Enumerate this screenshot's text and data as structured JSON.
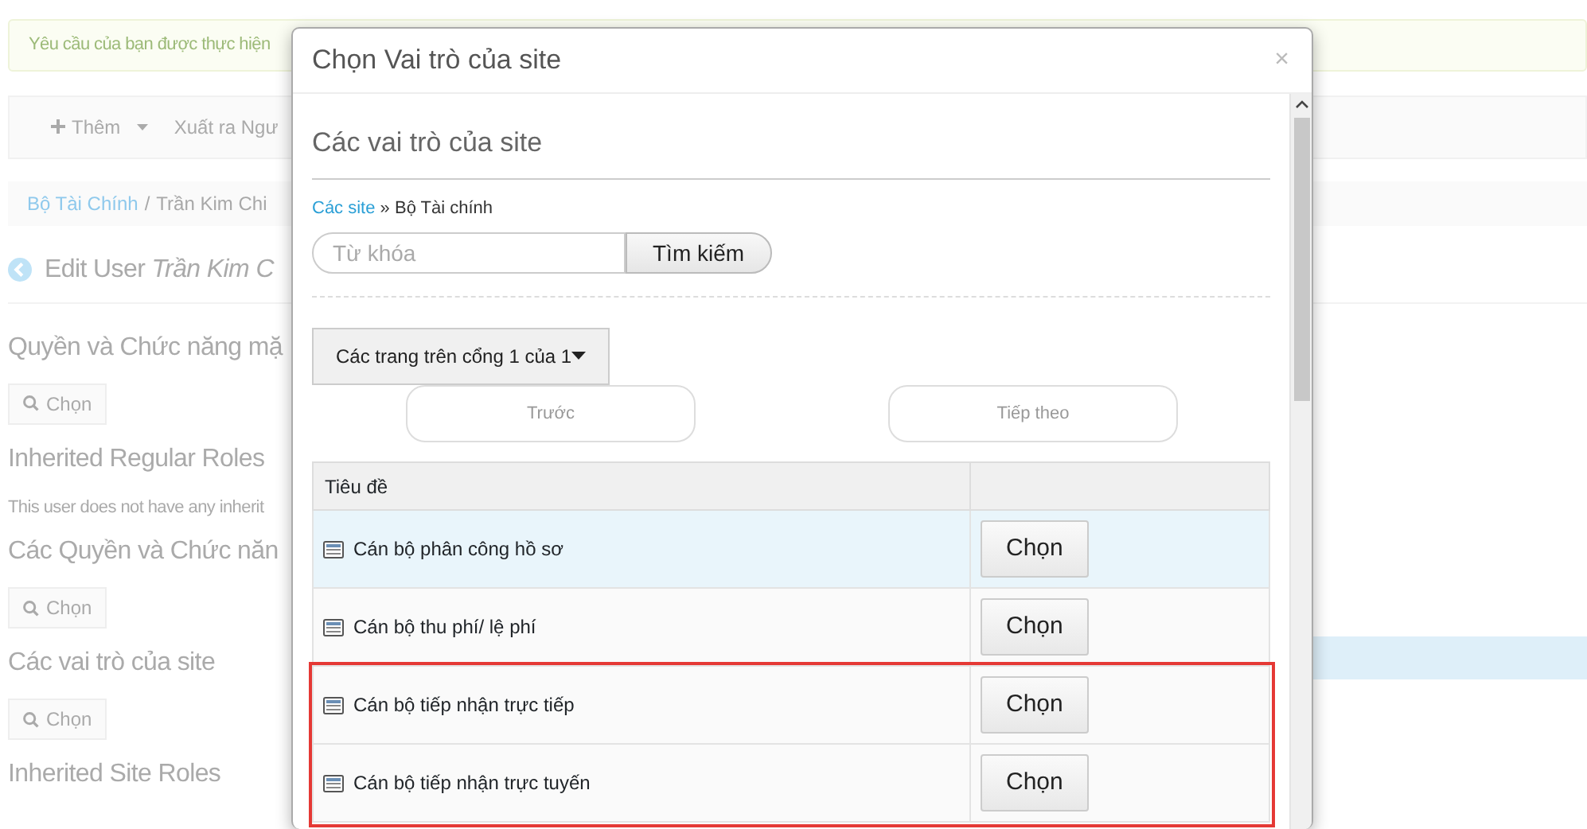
{
  "background": {
    "alert": "Yêu cầu của bạn được thực hiện",
    "toolbar": [
      {
        "label": "Thêm",
        "kind": "dropdown"
      },
      {
        "label": "Xuất ra Ngư",
        "kind": "link"
      }
    ],
    "breadcrumb": [
      {
        "label": "Bộ Tài Chính",
        "kind": "link"
      },
      {
        "label": "/",
        "kind": "separator"
      },
      {
        "label": "Trần Kim Chi",
        "kind": "current"
      }
    ],
    "title": {
      "prefix": "Edit User ",
      "name": "Trần Kim C"
    },
    "sections": [
      {
        "kind": "heading",
        "text": "Quyền và Chức năng mặ"
      },
      {
        "kind": "button",
        "text": "Chọn"
      },
      {
        "kind": "heading",
        "text": "Inherited Regular Roles"
      },
      {
        "kind": "note",
        "text": "This user does not have any inherit"
      },
      {
        "kind": "heading",
        "text": "Các Quyền và Chức năn"
      },
      {
        "kind": "button",
        "text": "Chọn"
      },
      {
        "kind": "heading",
        "text": "Các vai trò của site"
      },
      {
        "kind": "button",
        "text": "Chọn"
      },
      {
        "kind": "heading",
        "text": "Inherited Site Roles"
      }
    ]
  },
  "modal": {
    "title": "Chọn Vai trò của site",
    "close": "×",
    "heading": "Các vai trò của site",
    "breadcrumb": {
      "link": "Các site",
      "separator": "»",
      "current": "Bộ Tài chính"
    },
    "search": {
      "placeholder": "Từ khóa",
      "button": "Tìm kiếm"
    },
    "pages_dropdown": "Các trang trên cổng 1 của 1",
    "pager": [
      {
        "label": "Trước",
        "disabled": true
      },
      {
        "label": "Tiếp theo",
        "disabled": true
      }
    ],
    "table": {
      "columns": [
        "Tiêu đề"
      ],
      "rows": [
        {
          "title": "Cán bộ phân công hồ sơ",
          "action": "Chọn",
          "selected": true,
          "highlighted": false
        },
        {
          "title": "Cán bộ thu phí/ lệ phí",
          "action": "Chọn",
          "selected": false,
          "highlighted": false
        },
        {
          "title": "Cán bộ tiếp nhận trực tiếp",
          "action": "Chọn",
          "selected": false,
          "highlighted": true
        },
        {
          "title": "Cán bộ tiếp nhận trực tuyến",
          "action": "Chọn",
          "selected": false,
          "highlighted": true
        }
      ]
    }
  }
}
